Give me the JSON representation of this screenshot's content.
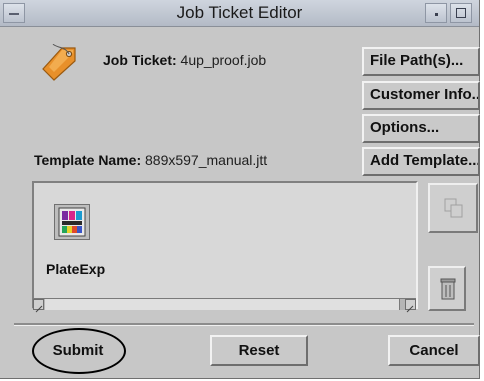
{
  "window": {
    "title": "Job Ticket Editor"
  },
  "job_ticket": {
    "label": "Job Ticket:",
    "value": "4up_proof.job"
  },
  "template": {
    "label": "Template Name:",
    "value": "889x597_manual.jtt"
  },
  "side_buttons": {
    "file_paths": "File Path(s)...",
    "customer_info": "Customer Info...",
    "options": "Options...",
    "add_template": "Add Template..."
  },
  "panel": {
    "items": [
      {
        "label": "PlateExp",
        "icon": "plate-exposure-icon"
      }
    ]
  },
  "footer": {
    "submit": "Submit",
    "reset": "Reset",
    "cancel": "Cancel"
  },
  "icons": {
    "ticket": "tag-icon",
    "copy": "copy-icon",
    "delete": "trash-icon"
  },
  "colors": {
    "window_bg": "#c7c7c7",
    "tag": "#e8902a",
    "annotation_circle": "#000000"
  }
}
